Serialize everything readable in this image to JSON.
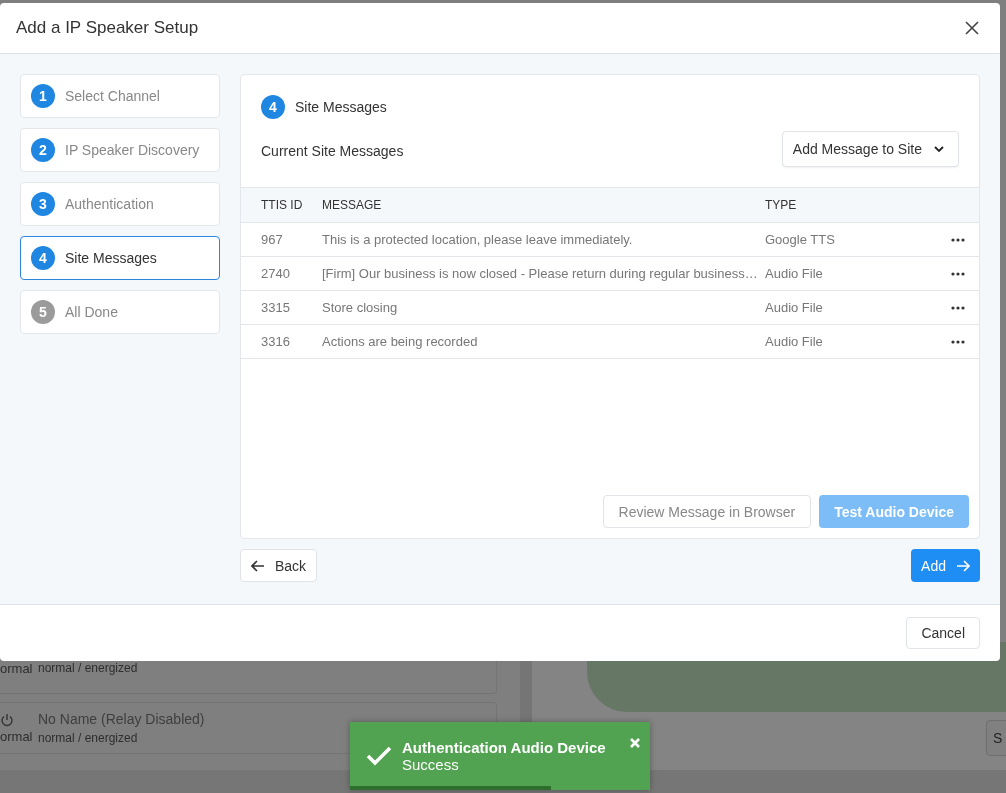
{
  "dialog": {
    "title": "Add a IP Speaker Setup"
  },
  "steps": [
    {
      "number": "1",
      "label": "Select Channel",
      "selected": false,
      "reached": true
    },
    {
      "number": "2",
      "label": "IP Speaker Discovery",
      "selected": false,
      "reached": true
    },
    {
      "number": "3",
      "label": "Authentication",
      "selected": false,
      "reached": true
    },
    {
      "number": "4",
      "label": "Site Messages",
      "selected": true,
      "reached": true
    },
    {
      "number": "5",
      "label": "All Done",
      "selected": false,
      "reached": false
    }
  ],
  "panel": {
    "step_number": "4",
    "step_title": "Site Messages",
    "section_title": "Current Site Messages",
    "add_dropdown": "Add Message to Site"
  },
  "table": {
    "columns": [
      "TTIS ID",
      "MESSAGE",
      "TYPE"
    ],
    "rows": [
      {
        "id": "967",
        "message": "This is a protected location, please leave immediately.",
        "type": "Google TTS"
      },
      {
        "id": "2740",
        "message": "[Firm] Our business is now closed - Please return during regular business…",
        "type": "Audio File"
      },
      {
        "id": "3315",
        "message": "Store closing",
        "type": "Audio File"
      },
      {
        "id": "3316",
        "message": "Actions are being recorded",
        "type": "Audio File"
      }
    ]
  },
  "panel_buttons": [
    {
      "label": "Review Message in Browser",
      "kind": "outline",
      "disabled": true
    },
    {
      "label": "Test Audio Device",
      "kind": "primary",
      "disabled": true
    }
  ],
  "back_button": "Back",
  "add_button": "Add",
  "cancel_button": "Cancel",
  "background": {
    "rows": [
      {
        "state": "ormal",
        "name": "",
        "detail": "normal / energized"
      },
      {
        "state": "ormal",
        "name": "No Name (Relay Disabled)",
        "detail": "normal / energized"
      }
    ],
    "side_button": "S"
  },
  "toast": {
    "title": "Authentication Audio Device",
    "message": "Success",
    "level": 0.67
  }
}
